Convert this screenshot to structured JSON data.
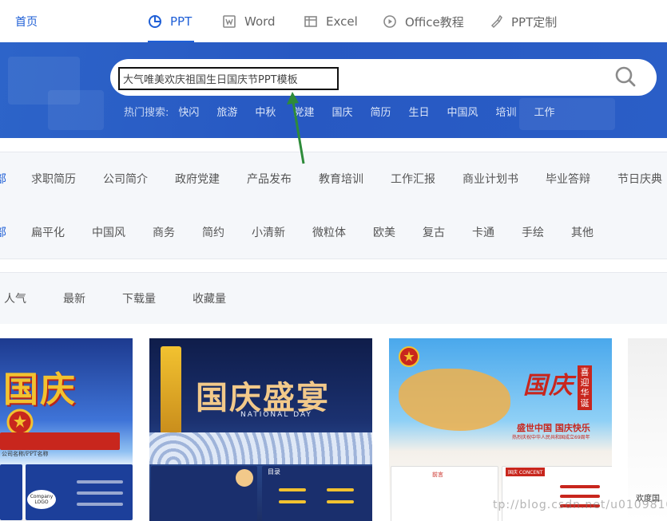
{
  "nav": {
    "home": "首页",
    "items": [
      {
        "label": "PPT",
        "icon": "pie-chart-icon"
      },
      {
        "label": "Word",
        "icon": "word-doc-icon"
      },
      {
        "label": "Excel",
        "icon": "table-grid-icon"
      },
      {
        "label": "Office教程",
        "icon": "play-circle-icon"
      },
      {
        "label": "PPT定制",
        "icon": "brush-icon"
      }
    ]
  },
  "search": {
    "value": "大气唯美欢庆祖国生日国庆节PPT模板",
    "hot_label": "热门搜索:",
    "hot_keywords": [
      "快闪",
      "旅游",
      "中秋",
      "党建",
      "国庆",
      "简历",
      "生日",
      "中国风",
      "培训",
      "工作"
    ]
  },
  "categories": {
    "cut": "部",
    "items": [
      "求职简历",
      "公司简介",
      "政府党建",
      "产品发布",
      "教育培训",
      "工作汇报",
      "商业计划书",
      "毕业答辩",
      "节日庆典"
    ]
  },
  "styles": {
    "cut": "部",
    "items": [
      "扁平化",
      "中国风",
      "商务",
      "简约",
      "小清新",
      "微粒体",
      "欧美",
      "复古",
      "卡通",
      "手绘",
      "其他"
    ]
  },
  "sort": {
    "items": [
      "人气",
      "最新",
      "下载量",
      "收藏量"
    ]
  },
  "thumbnails": {
    "t1": {
      "title": "国庆",
      "caption": "公司名称/PPT名称",
      "logo": "Company LOGO"
    },
    "t2": {
      "title": "国庆盛宴",
      "subtitle": "NATIONAL DAY",
      "toc": "目录"
    },
    "t3": {
      "title": "盛世中国 国庆快乐",
      "badge": "喜迎华诞",
      "sub": "热烈庆祝中华人民共和国成立69周年",
      "sec1": "前言",
      "sec2": "国庆 CONCENT"
    },
    "t4": {
      "title": "欢度国"
    }
  },
  "watermark": "tp://blog.csdn.net/u010981013",
  "colors": {
    "accent": "#1f5fd6",
    "banner": "#2758c2",
    "annotation": "#2e8b3a"
  }
}
